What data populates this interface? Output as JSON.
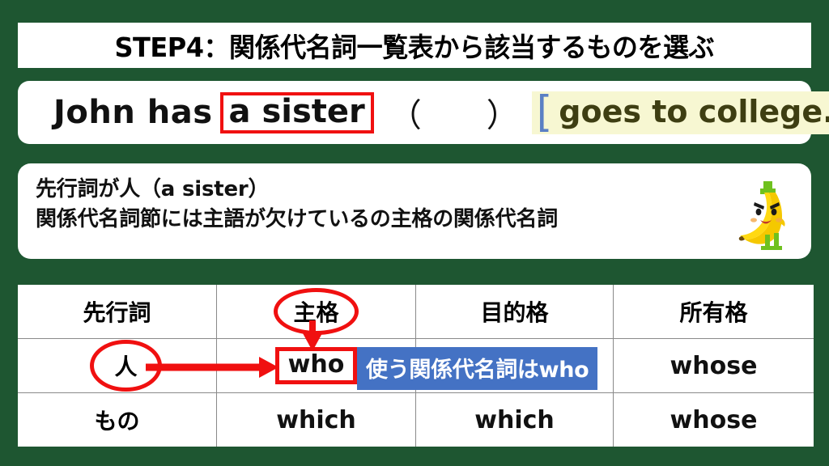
{
  "theme": {
    "background_green": "#1e5631",
    "accent_red": "#f01010",
    "callout_blue": "#4472c4",
    "highlight_yellow": "#f7f7d2",
    "bracket_blue": "#5a7fc4",
    "clause_text_olive": "#3e3e12"
  },
  "title": {
    "text": "STEP4：関係代名詞一覧表から該当するものを選ぶ"
  },
  "sentence": {
    "subject": "John has",
    "antecedent": "a sister",
    "blank": "（　　）",
    "bracket_open": "[",
    "clause": "goes to college.",
    "bracket_close": "]"
  },
  "explanation": {
    "line1": "先行詞が人（a sister）",
    "line2": "関係代名詞節には主語が欠けているの主格の関係代名詞"
  },
  "mascot": {
    "name": "angry-banana-character"
  },
  "table": {
    "headers": [
      "先行詞",
      "主格",
      "目的格",
      "所有格"
    ],
    "rows": [
      {
        "antecedent": "人",
        "subjective": "who",
        "objective": "",
        "possessive": "whose"
      },
      {
        "antecedent": "もの",
        "subjective": "which",
        "objective": "which",
        "possessive": "whose"
      }
    ]
  },
  "callout": {
    "text": "使う関係代名詞はwho"
  }
}
